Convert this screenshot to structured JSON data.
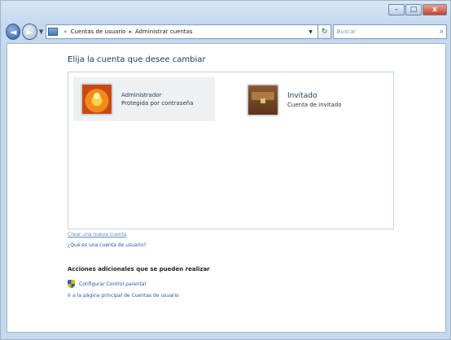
{
  "window": {
    "caption_buttons": {
      "minimize": "–",
      "maximize": "□",
      "close": "x"
    }
  },
  "navigation": {
    "back_icon": "◄",
    "forward_icon": "►",
    "dropdown_icon": "▼",
    "breadcrumb": {
      "prefix": "«",
      "items": [
        "Cuentas de usuario",
        "Administrar cuentas"
      ],
      "separator": "▸"
    },
    "address_dropdown_icon": "▼",
    "refresh_icon": "↻",
    "search": {
      "placeholder": "Buscar",
      "icon": "⌕"
    }
  },
  "main": {
    "title": "Elija la cuenta que desee cambiar",
    "accounts": [
      {
        "name": "Administrador",
        "subtitle": "Protegida por contraseña",
        "picture": "flower-icon"
      },
      {
        "name": "Invitado",
        "subtitle": "Cuenta de invitado",
        "picture": "chest-icon"
      }
    ],
    "links": {
      "create_account": "Crear una nueva cuenta",
      "what_is_account": "¿Qué es una cuenta de usuario?"
    },
    "additional_actions": {
      "heading": "Acciones adicionales que se pueden realizar",
      "items": [
        {
          "label": "Configurar Control parental",
          "icon": "shield-icon"
        }
      ],
      "home_link": "Ir a la página principal de Cuentas de usuario"
    }
  }
}
